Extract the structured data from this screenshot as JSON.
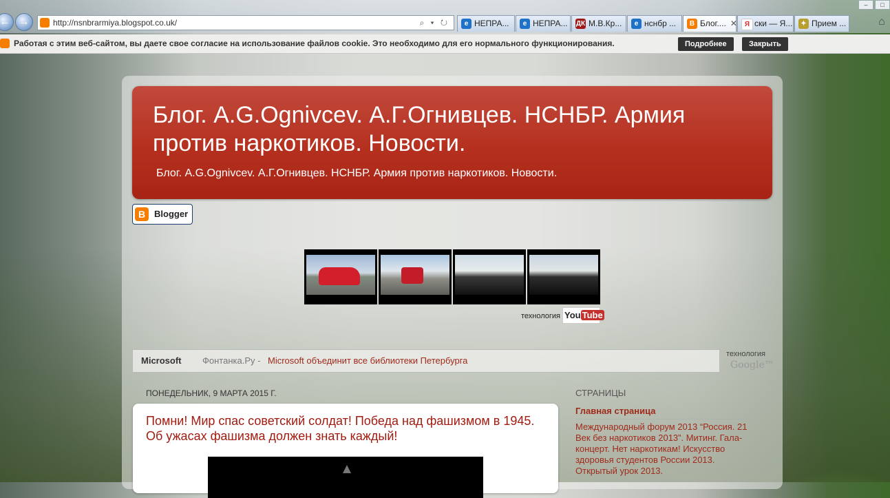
{
  "browser": {
    "url": "http://nsnbrarmiya.blogspot.co.uk/",
    "address_icons": "⌕ ▾ ↻",
    "tabs": [
      {
        "label": "НЕПРА...",
        "icon": "ie-icon",
        "icon_color": "#1e73c8"
      },
      {
        "label": "НЕПРА...",
        "icon": "ie-icon",
        "icon_color": "#1e73c8"
      },
      {
        "label": "М.В.Кр...",
        "icon": "dk-icon",
        "icon_color": "#a01818",
        "icon_text": "ДК"
      },
      {
        "label": "нснбр ...",
        "icon": "ie-icon",
        "icon_color": "#1e73c8"
      },
      {
        "label": "Блог....",
        "icon": "blogger-icon",
        "icon_color": "#f57d00",
        "active": true,
        "close": "✕"
      },
      {
        "label": "ски — Я...",
        "icon": "yandex-icon",
        "icon_color": "#e03030",
        "icon_text": "Я"
      },
      {
        "label": "Прием ...",
        "icon": "eagle-icon",
        "icon_color": "#b8a030"
      }
    ]
  },
  "cookie_bar": {
    "text": "Работая с этим веб-сайтом, вы даете свое согласие на использование файлов cookie. Это необходимо для его нормального функционирования.",
    "more_label": "Подробнее",
    "close_label": "Закрыть"
  },
  "blog": {
    "title": "Блог. A.G.Ognivcev. А.Г.Огнивцев. НСНБР. Армия против наркотиков. Новости.",
    "description": "Блог. A.G.Ognivcev. А.Г.Огнивцев. НСНБР. Армия против наркотиков. Новости.",
    "badge": "Blogger",
    "brand_color": "#b5301f"
  },
  "youtube": {
    "tech_label": "технология",
    "logo_you": "You",
    "logo_tube": "Tube"
  },
  "news": {
    "label": "Microsoft",
    "source": "Фонтанка.Ру -",
    "headline": "Microsoft объединит все библиотеки Петербурга",
    "tech_label": "технология",
    "google_label": "Google™"
  },
  "post": {
    "date": "ПОНЕДЕЛЬНИК, 9 МАРТА 2015 Г.",
    "title": "Помни! Мир спас советский солдат! Победа над фашизмом в 1945. Об ужасах фашизма должен знать каждый!"
  },
  "sidebar": {
    "heading": "СТРАНИЦЫ",
    "main_link": "Главная страница",
    "item": "Международный форум 2013 “Россия. 21 Век без наркотиков 2013”. Митинг. Гала-концерт. Нет наркотикам! Искусство здоровья студентов России 2013. Открытый урок 2013."
  }
}
